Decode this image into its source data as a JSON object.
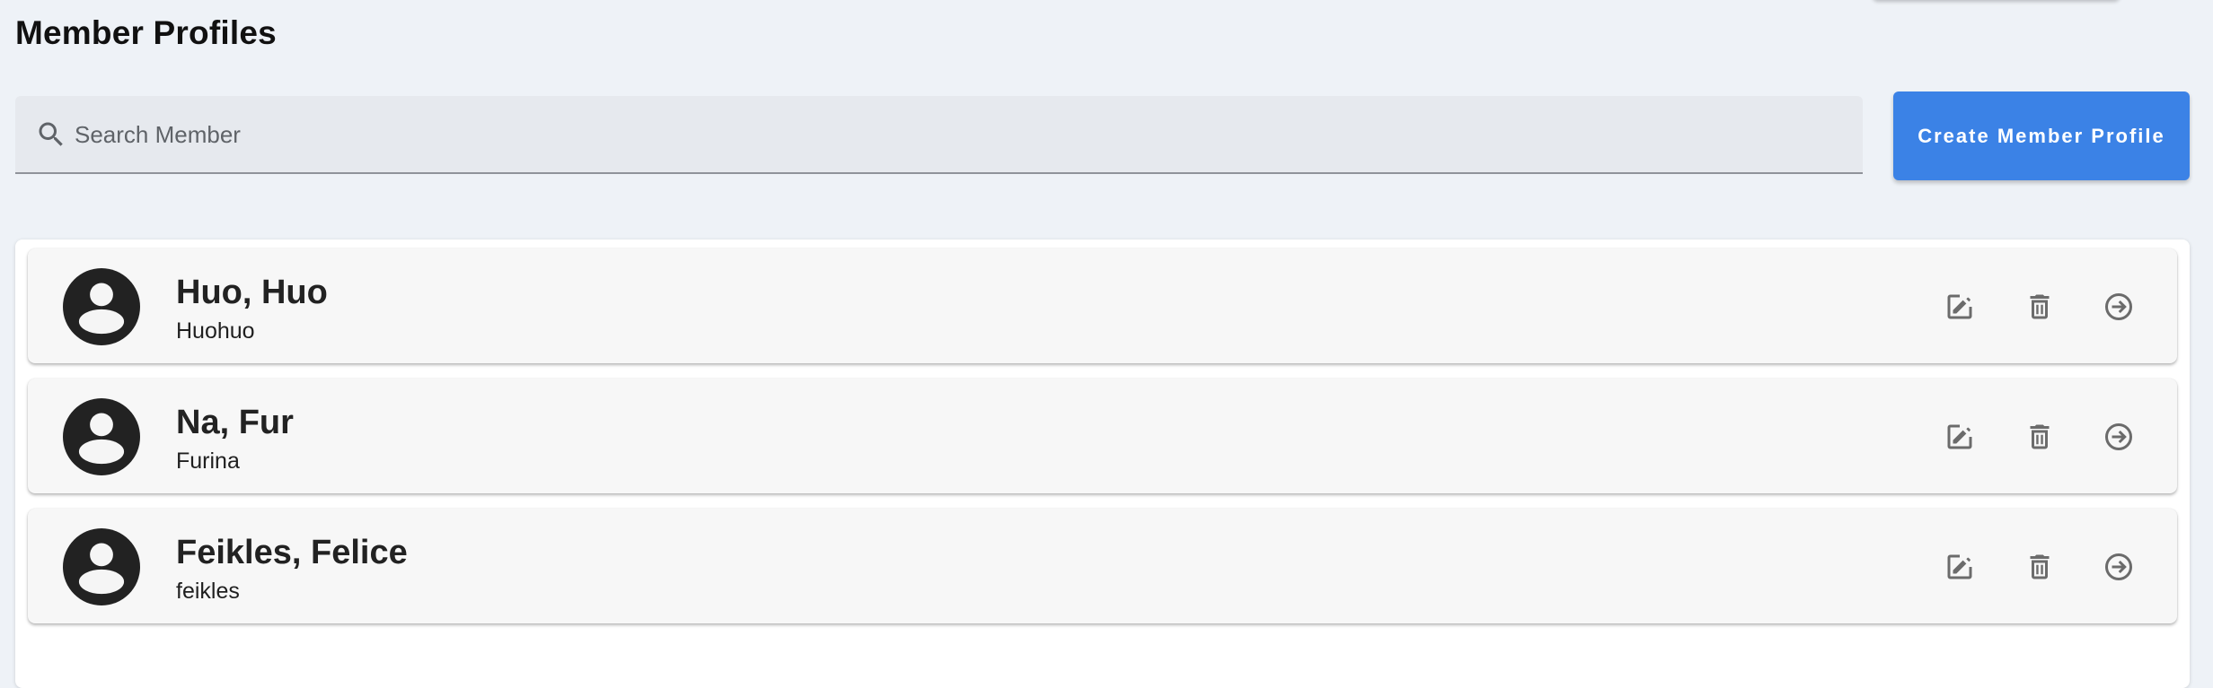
{
  "header": {
    "title": "Member Profiles"
  },
  "search": {
    "placeholder": "Search Member",
    "value": "",
    "icon": "search-icon"
  },
  "toolbar": {
    "create_label": "Create Member Profile"
  },
  "colors": {
    "background": "#eef2f7",
    "accent": "#3b82e6",
    "card": "#f7f7f7",
    "icon": "#6b6b6b",
    "avatar": "#222222"
  },
  "members": [
    {
      "name": "Huo, Huo",
      "username": "Huohuo"
    },
    {
      "name": "Na, Fur",
      "username": "Furina"
    },
    {
      "name": "Feikles, Felice",
      "username": "feikles"
    }
  ],
  "actions": {
    "edit_icon": "edit-icon",
    "delete_icon": "trash-icon",
    "open_icon": "arrow-circle-right-icon"
  }
}
